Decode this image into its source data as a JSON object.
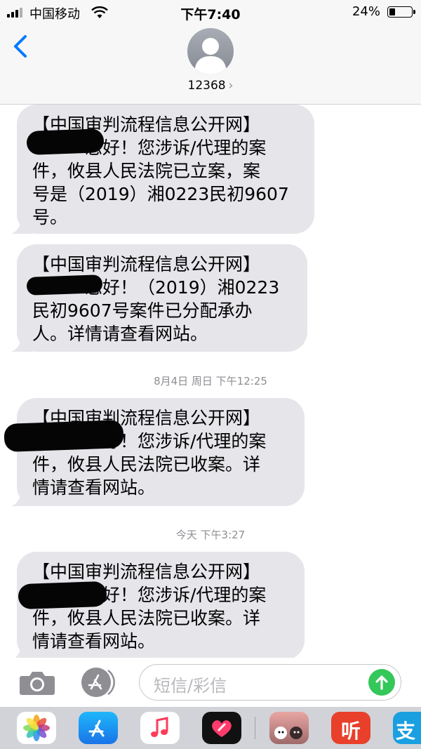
{
  "status": {
    "carrier": "中国移动",
    "time": "下午7:40",
    "battery": "24%"
  },
  "header": {
    "contact": "12368",
    "chevron": "›"
  },
  "messages": [
    {
      "text": "【中国审判流程信息公开网】\n　　　您好！您涉诉/代理的案\n件，攸县人民法院已立案，案\n号是（2019）湘0223民初9607\n号。"
    },
    {
      "text": "【中国审判流程信息公开网】\n　　　您好！（2019）湘0223\n民初9607号案件已分配承办\n人。详情请查看网站。"
    },
    {
      "text": "【中国审判流程信息公开网】\n　　　您好！您涉诉/代理的案\n件，攸县人民法院已收案。详\n情请查看网站。"
    },
    {
      "text": "【中国审判流程信息公开网】\n　　　您好！您涉诉/代理的案\n件，攸县人民法院已收案。详\n情请查看网站。"
    }
  ],
  "timestamps": [
    "8月4日 周日 下午12:25",
    "今天 下午3:27"
  ],
  "composer": {
    "placeholder": "短信/彩信"
  },
  "tray": {
    "icons": [
      "photos-icon",
      "app-store-icon",
      "music-icon",
      "digital-touch-icon",
      "sticker-app-icon",
      "ting-app-icon",
      "alipay-icon"
    ],
    "ting_label": "听",
    "alipay_label": "支"
  }
}
